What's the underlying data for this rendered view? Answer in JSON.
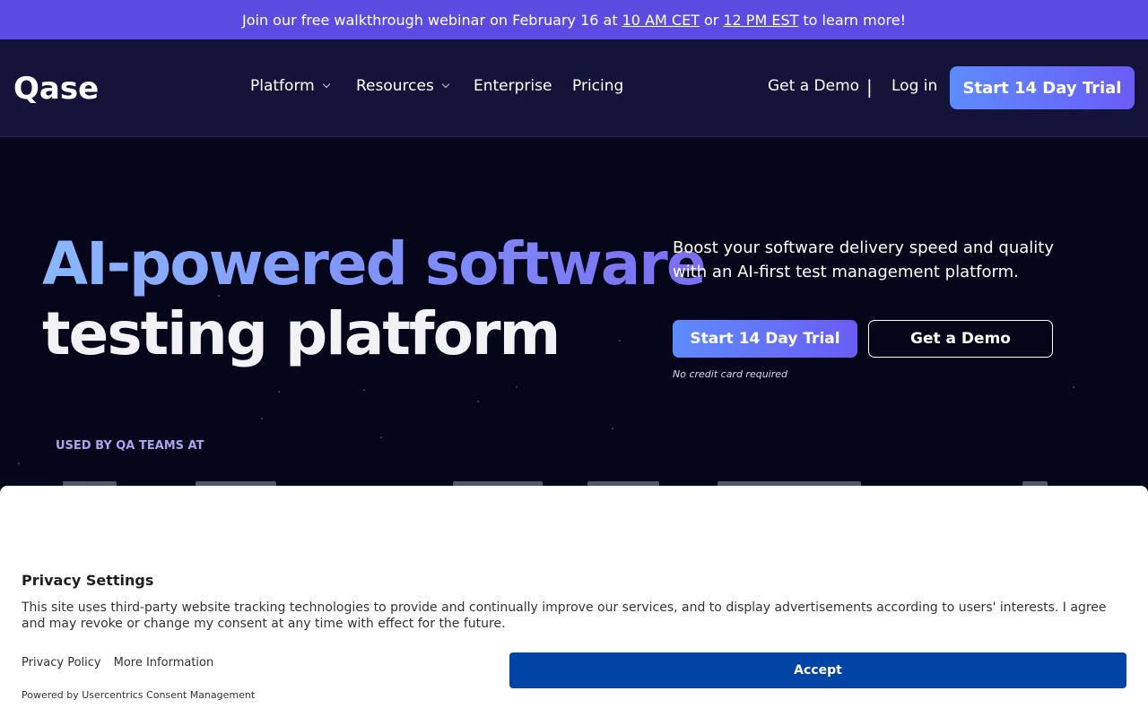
{
  "banner": {
    "text_before": "Join our free walkthrough webinar on February 16 at",
    "link1": "10 AM CET",
    "text_mid": "or",
    "link2": "12 PM EST",
    "text_after": "to learn more!"
  },
  "header": {
    "logo": "Qase",
    "nav": [
      "Platform",
      "Resources",
      "Enterprise",
      "Pricing"
    ],
    "get_demo": "Get a Demo",
    "separator": "|",
    "login": "Log in",
    "cta": "Start 14 Day Trial"
  },
  "hero": {
    "title_line1": "AI-powered software",
    "title_line2": "testing platform",
    "lead": "Boost your software delivery speed and quality with an AI-first test management platform.",
    "primary_cta": "Start 14 Day Trial",
    "secondary_cta": "Get a Demo",
    "note": "No credit card required",
    "used_by": "USED BY QA TEAMS AT"
  },
  "consent": {
    "title": "Privacy Settings",
    "text": "This site uses third-party website tracking technologies to provide and continually improve our services, and to display advertisements according to users' interests. I agree and may revoke or change my consent at any time with effect for the future.",
    "privacy_policy": "Privacy Policy",
    "more_info": "More Information",
    "powered_by": "Powered by Usercentrics Consent Management",
    "accept": "Accept"
  },
  "colors": {
    "banner": "#5b4be0",
    "nav_bg": "#14143a",
    "hero_bg": "#05061a",
    "cta_gradient_start": "#5e8bff",
    "cta_gradient_end": "#6a5cf6",
    "accept": "#0045a5"
  }
}
